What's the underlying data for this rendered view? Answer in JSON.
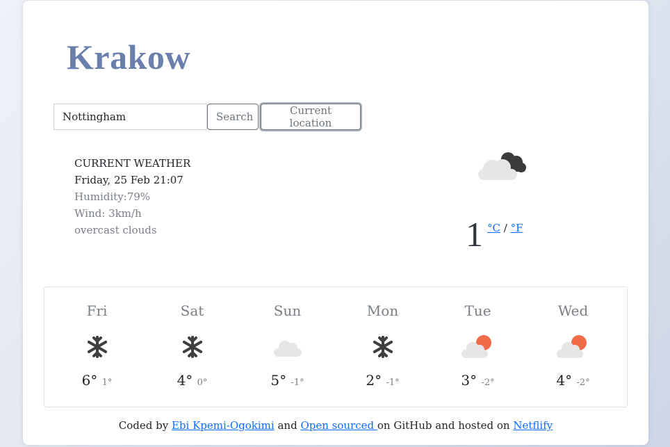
{
  "city": "Krakow",
  "search": {
    "value": "Nottingham",
    "search_label": "Search",
    "location_label": "Current location"
  },
  "current": {
    "heading": "CURRENT WEATHER",
    "datetime": "Friday, 25 Feb 21:07",
    "humidity": "Humidity:79%",
    "wind": "Wind: 3km/h",
    "description": "overcast clouds",
    "icon": "overcast-clouds-icon",
    "temperature": "1",
    "unit_c": "°C",
    "unit_sep": "/",
    "unit_f": "°F"
  },
  "forecast": [
    {
      "day": "Fri",
      "icon": "snow-icon",
      "high": "6°",
      "low": "1°"
    },
    {
      "day": "Sat",
      "icon": "snow-icon",
      "high": "4°",
      "low": "0°"
    },
    {
      "day": "Sun",
      "icon": "cloud-icon",
      "high": "5°",
      "low": "-1°"
    },
    {
      "day": "Mon",
      "icon": "snow-icon",
      "high": "2°",
      "low": "-1°"
    },
    {
      "day": "Tue",
      "icon": "sun-behind-cloud-icon",
      "high": "3°",
      "low": "-2°"
    },
    {
      "day": "Wed",
      "icon": "sun-behind-cloud-icon",
      "high": "4°",
      "low": "-2°"
    }
  ],
  "footer": {
    "prefix": "Coded by ",
    "author": "Ebi Kpemi-Ogokimi",
    "middle1": " and ",
    "source_link": "Open sourced ",
    "middle2": "on GitHub and hosted on ",
    "host_link": "Netflify"
  },
  "colors": {
    "city": "#6b7fad",
    "link": "#0d6efd",
    "sun": "#ef6b4a",
    "cloud": "#e6e6e6",
    "dark_cloud": "#3b3b3b"
  }
}
